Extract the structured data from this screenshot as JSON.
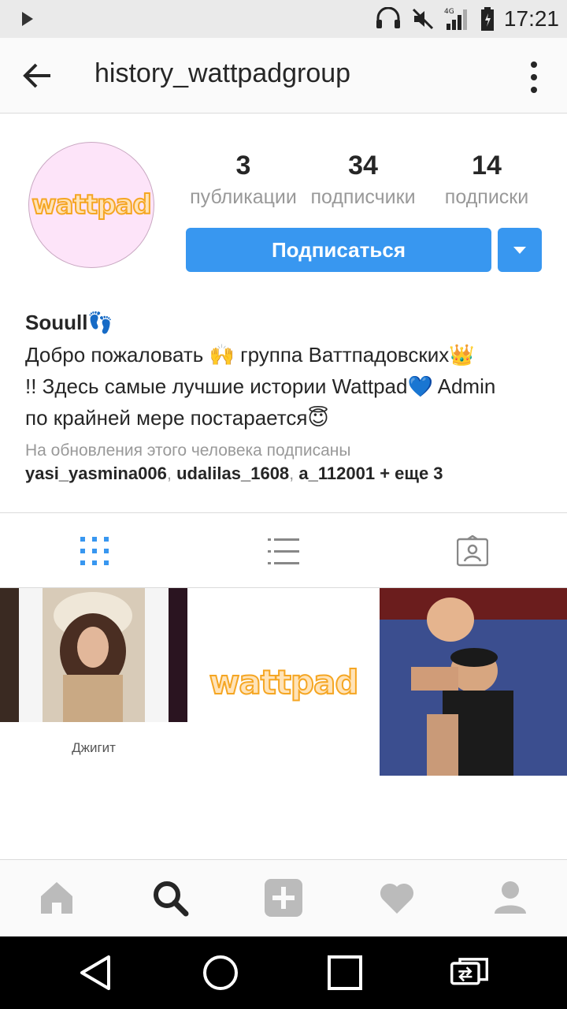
{
  "status_bar": {
    "time": "17:21",
    "network": "4G"
  },
  "header": {
    "title": "history_wattpadgroup"
  },
  "profile": {
    "avatar_text": "wattpad",
    "stats": [
      {
        "value": "3",
        "label": "публикации"
      },
      {
        "value": "34",
        "label": "подписчики"
      },
      {
        "value": "14",
        "label": "подписки"
      }
    ],
    "follow_label": "Подписаться",
    "name": "Souull👣",
    "bio_line1": "Добро пожаловать 🙌 группа Ваттпадовских👑",
    "bio_line2": "!! Здесь самые лучшие истории Wattpad💙 Admin",
    "bio_line3": "по крайней мере постарается😇",
    "followed_by_label": "На обновления этого человека подписаны",
    "followers": [
      "yasi_yasmina006",
      "udalilas_1608",
      "a_112001"
    ],
    "followers_more": "+ еще 3"
  },
  "grid": {
    "post1_caption": "Джигит",
    "post2_text": "wattpad"
  },
  "colors": {
    "accent": "#3897f0",
    "wattpad": "#f5a623"
  }
}
